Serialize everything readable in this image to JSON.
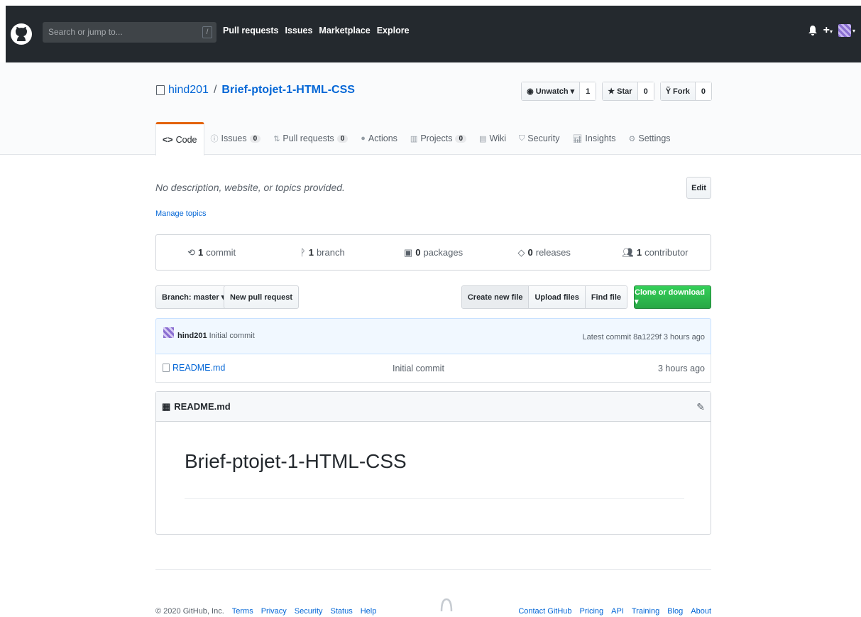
{
  "topbar": {
    "search_placeholder": "Search or jump to...",
    "search_key": "/",
    "nav": [
      "Pull requests",
      "Issues",
      "Marketplace",
      "Explore"
    ],
    "plus": "+",
    "caret": "▾"
  },
  "repo": {
    "owner": "hind201",
    "separator": "/",
    "name": "Brief-ptojet-1-HTML-CSS",
    "watch_label": "Unwatch ▾",
    "watch_count": "1",
    "star_label": "Star",
    "star_count": "0",
    "fork_label": "Fork",
    "fork_count": "0"
  },
  "tabs": [
    {
      "label": "Code",
      "counter": ""
    },
    {
      "label": "Issues",
      "counter": "0"
    },
    {
      "label": "Pull requests",
      "counter": "0"
    },
    {
      "label": "Actions",
      "counter": ""
    },
    {
      "label": "Projects",
      "counter": "0"
    },
    {
      "label": "Wiki",
      "counter": ""
    },
    {
      "label": "Security",
      "counter": ""
    },
    {
      "label": "Insights",
      "counter": ""
    },
    {
      "label": "Settings",
      "counter": ""
    }
  ],
  "description": "No description, website, or topics provided.",
  "edit_label": "Edit",
  "manage_topics": "Manage topics",
  "summary": {
    "commits_n": "1",
    "commits_t": "commit",
    "branches_n": "1",
    "branches_t": "branch",
    "packages_n": "0",
    "packages_t": "packages",
    "releases_n": "0",
    "releases_t": "releases",
    "contributors_n": "1",
    "contributors_t": "contributor"
  },
  "filebar": {
    "branch": "Branch: master ▾",
    "new_pr": "New pull request",
    "create": "Create new file",
    "upload": "Upload files",
    "find": "Find file",
    "clone": "Clone or download ▾"
  },
  "commit": {
    "user": "hind201",
    "message": "Initial commit",
    "latest": "Latest commit 8a1229f 3 hours ago"
  },
  "files": [
    {
      "name": "README.md",
      "message": "Initial commit",
      "age": "3 hours ago"
    }
  ],
  "readme": {
    "header": "README.md",
    "h1": "Brief-ptojet-1-HTML-CSS"
  },
  "footer": {
    "copyright": "© 2020 GitHub, Inc.",
    "left_links": [
      "Terms",
      "Privacy",
      "Security",
      "Status",
      "Help"
    ],
    "right_links": [
      "Contact GitHub",
      "Pricing",
      "API",
      "Training",
      "Blog",
      "About"
    ]
  }
}
